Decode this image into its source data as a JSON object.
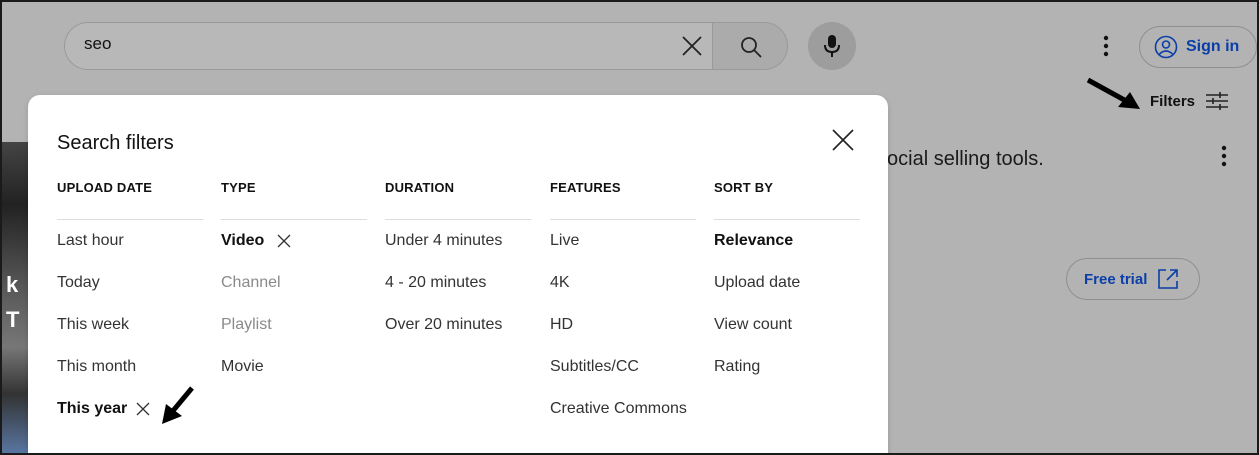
{
  "topbar": {
    "search_value": "seo",
    "sign_in": "Sign in",
    "filters": "Filters"
  },
  "background": {
    "headline": "ocial selling tools.",
    "free_trial": "Free trial"
  },
  "modal": {
    "title": "Search filters",
    "columns": [
      {
        "header": "UPLOAD DATE",
        "options": [
          "Last hour",
          "Today",
          "This week",
          "This month",
          "This year"
        ]
      },
      {
        "header": "TYPE",
        "options": [
          "Video",
          "Channel",
          "Playlist",
          "Movie"
        ]
      },
      {
        "header": "DURATION",
        "options": [
          "Under 4 minutes",
          "4 - 20 minutes",
          "Over 20 minutes"
        ]
      },
      {
        "header": "FEATURES",
        "options": [
          "Live",
          "4K",
          "HD",
          "Subtitles/CC",
          "Creative Commons"
        ]
      },
      {
        "header": "SORT BY",
        "options": [
          "Relevance",
          "Upload date",
          "View count",
          "Rating"
        ]
      }
    ]
  },
  "colors": {
    "link_blue": "#0b3ea8",
    "overlay_gray": "#b3b3b3"
  }
}
